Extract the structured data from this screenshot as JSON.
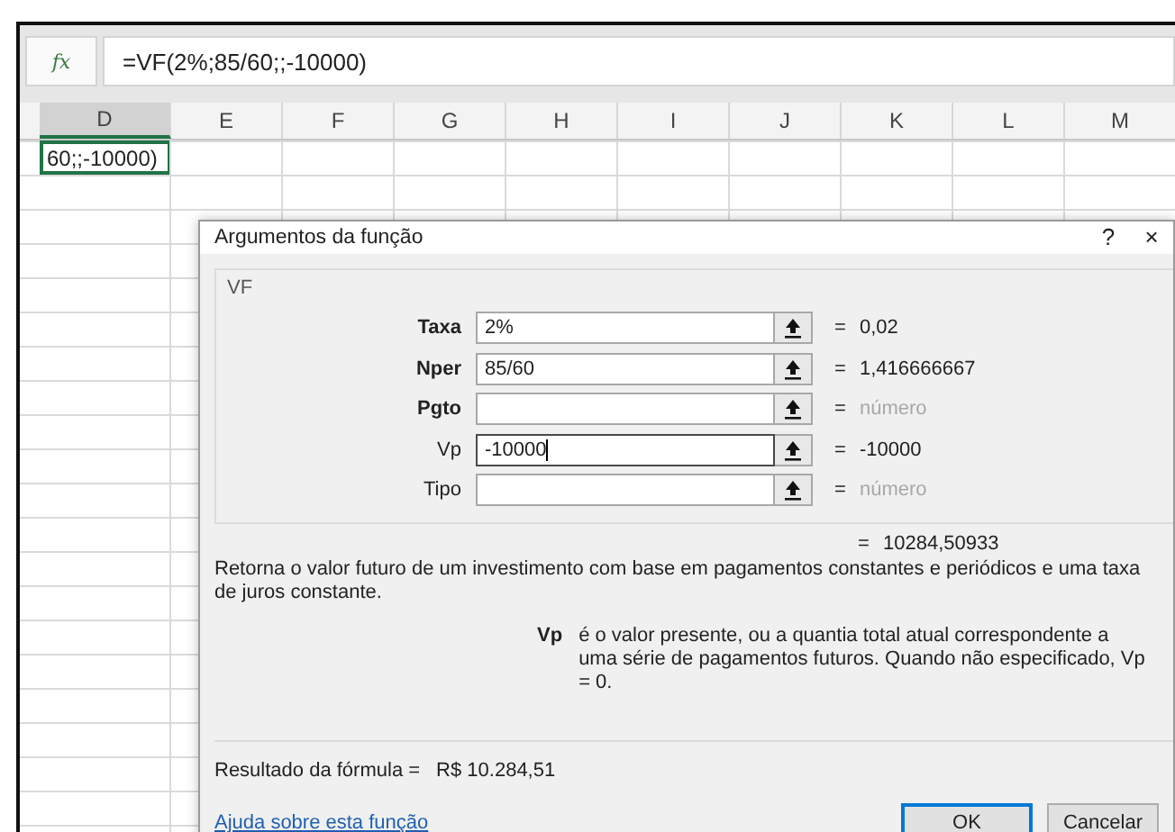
{
  "formula_bar": {
    "function_label": "fx",
    "formula": "=VF(2%;85/60;;-10000)"
  },
  "sheet": {
    "columns": [
      {
        "label": "D",
        "selected": true
      },
      {
        "label": "E",
        "selected": false
      },
      {
        "label": "F",
        "selected": false
      },
      {
        "label": "G",
        "selected": false
      },
      {
        "label": "H",
        "selected": false
      },
      {
        "label": "I",
        "selected": false
      },
      {
        "label": "J",
        "selected": false
      },
      {
        "label": "K",
        "selected": false
      },
      {
        "label": "L",
        "selected": false
      },
      {
        "label": "M",
        "selected": false
      }
    ],
    "active_cell": "60;;-10000)"
  },
  "dialog": {
    "title": "Argumentos da função",
    "help": "?",
    "close": "×",
    "group": "VF",
    "arguments": [
      {
        "label": "Taxa",
        "required": true,
        "value": "2%",
        "focused": false,
        "equals": "=",
        "result": "0,02",
        "result_hint": false
      },
      {
        "label": "Nper",
        "required": true,
        "value": "85/60",
        "focused": false,
        "equals": "=",
        "result": "1,416666667",
        "result_hint": false
      },
      {
        "label": "Pgto",
        "required": true,
        "focused": false,
        "equals": "=",
        "result": "número",
        "result_hint": true
      },
      {
        "label": "Vp",
        "required": false,
        "value": "-10000",
        "focused": true,
        "equals": "=",
        "result": "-10000",
        "result_hint": false
      },
      {
        "label": "Tipo",
        "required": false,
        "focused": false,
        "equals": "=",
        "result": "número",
        "result_hint": true
      }
    ],
    "total_equals": "=",
    "total": "10284,50933",
    "description": "Retorna o valor futuro de um investimento com base em pagamentos constantes e periódicos e uma taxa de juros constante.",
    "param_help": {
      "name": "Vp",
      "text": "é o valor presente, ou a quantia total atual correspondente a uma série de pagamentos futuros. Quando não especificado, Vp = 0."
    },
    "formula_result_label": "Resultado da fórmula =",
    "formula_result": "R$ 10.284,51",
    "help_link": "Ajuda sobre esta função",
    "buttons": [
      {
        "label": "OK",
        "default": true
      },
      {
        "label": "Cancelar",
        "default": false
      }
    ]
  }
}
